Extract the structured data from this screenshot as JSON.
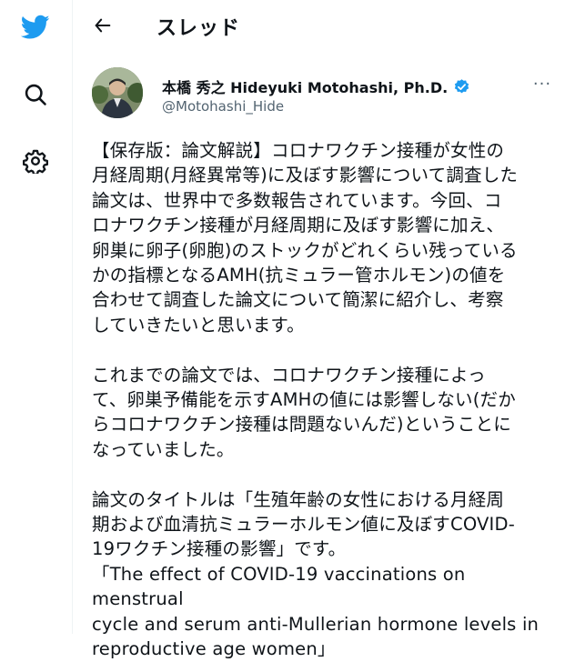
{
  "header": {
    "title": "スレッド"
  },
  "sidebar": {
    "items": [
      "twitter-logo",
      "search-icon",
      "gear-icon"
    ]
  },
  "tweet": {
    "author_name": "本橋 秀之 Hideyuki Motohashi, Ph.D.",
    "handle": "@Motohashi_Hide",
    "more": "···",
    "paragraphs": [
      "【保存版：論文解説】コロナワクチン接種が女性の\n月経周期(月経異常等)に及ぼす影響について調査した\n論文は、世界中で多数報告されています。今回、コ\nロナワクチン接種が月経周期に及ぼす影響に加え、\n卵巣に卵子(卵胞)のストックがどれくらい残っている\nかの指標となるAMH(抗ミュラー管ホルモン)の値を\n合わせて調査した論文について簡潔に紹介し、考察\nしていきたいと思います。",
      "これまでの論文では、コロナワクチン接種によっ\nて、卵巣予備能を示すAMHの値には影響しない(だか\nらコロナワクチン接種は問題ないんだ)ということに\nなっていました。",
      "論文のタイトルは「生殖年齢の女性における月経周\n期および血清抗ミュラーホルモン値に及ぼすCOVID-\n19ワクチン接種の影響」です。\n「The effect of COVID-19 vaccinations on menstrual\ncycle and serum anti-Mullerian hormone levels in\nreproductive age women」"
    ]
  },
  "colors": {
    "brand": "#1d9bf0",
    "text": "#0f1419",
    "secondary": "#536471"
  }
}
